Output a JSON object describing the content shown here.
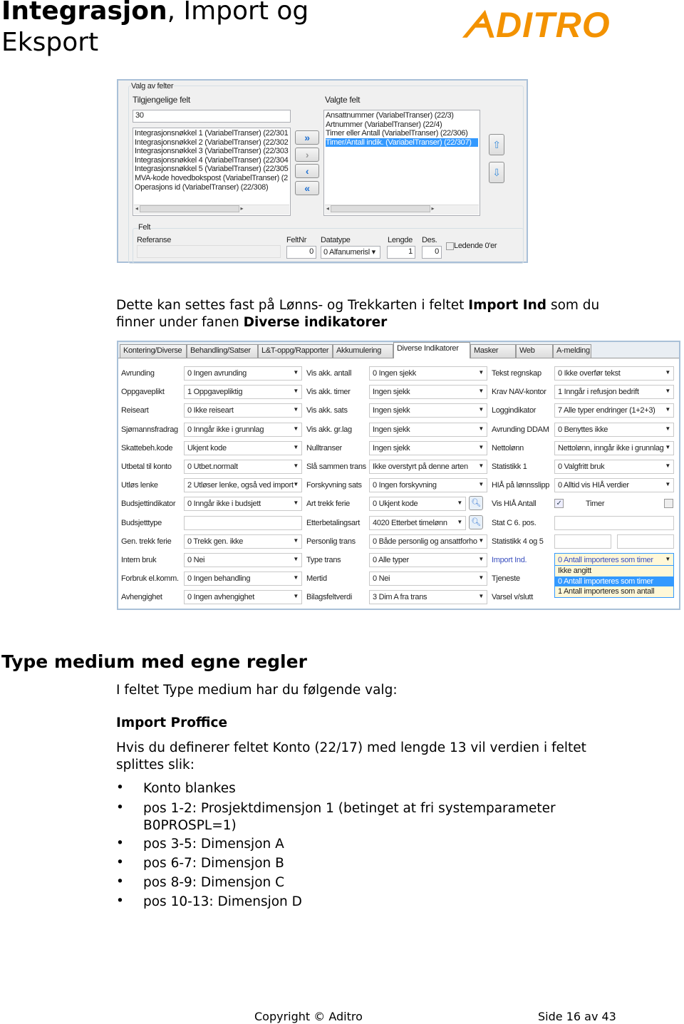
{
  "header": {
    "title_bold": "Integrasjon",
    "title_rest": ", Import og Eksport",
    "logo_text": "ADITRO",
    "logo_color": "#f39200"
  },
  "field_picker": {
    "group_label": "Valg av felter",
    "available_label": "Tilgjengelige felt",
    "search_value": "30",
    "available_items": [
      "Integrasjonsnøkkel 1 (VariabelTranser) (22/301",
      "Integrasjonsnøkkel 2 (VariabelTranser) (22/302",
      "Integrasjonsnøkkel 3 (VariabelTranser) (22/303",
      "Integrasjonsnøkkel 4 (VariabelTranser) (22/304",
      "Integrasjonsnøkkel 5 (VariabelTranser) (22/305",
      "MVA-kode hovedbokspost (VariabelTranser) (2",
      "Operasjons id (VariabelTranser) (22/308)"
    ],
    "selected_label": "Valgte felt",
    "selected_items": [
      "Ansattnummer (VariabelTranser) (22/3)",
      "Artnummer (VariabelTranser) (22/4)",
      "Timer eller Antall (VariabelTranser) (22/306)",
      "Timer/Antall indik. (VariabelTranser) (22/307)"
    ],
    "highlighted_index": 3,
    "buttons": {
      "add_all": "»",
      "add": "›",
      "remove": "‹",
      "remove_all": "«",
      "up": "⇧",
      "down": "⇩"
    },
    "felt": {
      "group_label": "Felt",
      "ref_label": "Referanse",
      "ref_value": "",
      "feltnr_label": "FeltNr",
      "feltnr_value": "0",
      "datatype_label": "Datatype",
      "datatype_value": "0 Alfanumerisl",
      "lengde_label": "Lengde",
      "lengde_value": "1",
      "des_label": "Des.",
      "des_value": "0",
      "leading_zero_label": "Ledende 0'er"
    }
  },
  "para1": {
    "text1": "Dette kan settes fast på Lønns- og Trekkarten i feltet ",
    "bold1": "Import Ind",
    "text2": " som du finner under fanen ",
    "bold2": "Diverse indikatorer"
  },
  "indicators": {
    "tabs": [
      "Kontering/Diverse",
      "Behandling/Satser",
      "L&T-oppg/Rapporter",
      "Akkumulering",
      "Diverse Indikatorer",
      "Masker",
      "Web",
      "A-melding"
    ],
    "active_tab": 4,
    "col1": [
      {
        "label": "Avrunding",
        "value": "0 Ingen avrunding"
      },
      {
        "label": "Oppgaveplikt",
        "value": "1 Oppgavepliktig"
      },
      {
        "label": "Reiseart",
        "value": "0 Ikke reiseart"
      },
      {
        "label": "Sjømannsfradrag",
        "value": "0 Inngår ikke i grunnlag"
      },
      {
        "label": "Skattebeh.kode",
        "value": "Ukjent kode"
      },
      {
        "label": "Utbetal til konto",
        "value": "0 Utbet.normalt"
      },
      {
        "label": "Utløs lenke",
        "value": "2 Utløser lenke, også ved import"
      },
      {
        "label": "Budsjettindikator",
        "value": "0 Inngår ikke i budsjett"
      },
      {
        "label": "Budsjetttype",
        "value": "",
        "text": true
      },
      {
        "label": "Gen. trekk ferie",
        "value": "0 Trekk gen. ikke"
      },
      {
        "label": "Intern bruk",
        "value": "0 Nei"
      },
      {
        "label": "Forbruk el.komm.",
        "value": "0 Ingen behandling"
      },
      {
        "label": "Avhengighet",
        "value": "0 Ingen avhengighet"
      }
    ],
    "col2": [
      {
        "label": "Vis akk. antall",
        "value": "0 Ingen sjekk"
      },
      {
        "label": "Vis akk. timer",
        "value": "Ingen sjekk"
      },
      {
        "label": "Vis akk. sats",
        "value": "Ingen sjekk"
      },
      {
        "label": "Vis akk. gr.lag",
        "value": "Ingen sjekk"
      },
      {
        "label": "Nulltranser",
        "value": "Ingen sjekk"
      },
      {
        "label": "Slå sammen trans",
        "value": "Ikke overstyrt på denne arten"
      },
      {
        "label": "Forskyvning sats",
        "value": "0 Ingen forskyvning"
      },
      {
        "label": "Art trekk ferie",
        "value": "0 Ukjent kode",
        "lookup": true
      },
      {
        "label": "Etterbetalingsart",
        "value": "4020 Etterbet timelønn",
        "lookup": true
      },
      {
        "label": "Personlig trans",
        "value": "0 Både personlig og ansattforho"
      },
      {
        "label": "Type trans",
        "value": "0 Alle typer"
      },
      {
        "label": "Mertid",
        "value": "0 Nei"
      },
      {
        "label": "Bilagsfeltverdi",
        "value": "3 Dim A fra trans"
      }
    ],
    "col3": [
      {
        "label": "Tekst regnskap",
        "value": "0 Ikke overfør tekst"
      },
      {
        "label": "Krav NAV-kontor",
        "value": "1 Inngår i refusjon bedrift"
      },
      {
        "label": "Loggindikator",
        "value": "7 Alle typer endringer (1+2+3)"
      },
      {
        "label": "Avrunding DDAM",
        "value": "0 Benyttes ikke"
      },
      {
        "label": "Nettolønn",
        "value": "Nettolønn, inngår ikke i grunnlag"
      },
      {
        "label": "Statistikk 1",
        "value": "0 Valgfritt bruk"
      },
      {
        "label": "HIÅ på lønnsslipp",
        "value": "0 Alltid vis HIÅ verdier"
      },
      {
        "label": "Vis HIÅ Antall",
        "checkbox": true,
        "checked": true,
        "extra_label": "Timer",
        "extra_checked": false
      },
      {
        "label": "Stat C 6. pos.",
        "value": "",
        "text": true
      },
      {
        "label": "Statistikk 4 og 5",
        "value": "",
        "split": true
      },
      {
        "label": "Import Ind.",
        "value": "0 Antall importeres som timer",
        "focus": true
      },
      {
        "label": "Tjeneste",
        "value": "",
        "hidden": true
      },
      {
        "label": "Varsel v/slutt",
        "value": "",
        "hidden": true
      }
    ],
    "dropdown_options": [
      "Ikke angitt",
      "0 Antall importeres som timer",
      "1 Antall importeres som antall"
    ],
    "dropdown_selected": 1
  },
  "section": {
    "title": "Type medium med egne regler",
    "intro": "I feltet Type medium har du følgende valg:",
    "subtitle": "Import Proffice",
    "para": "Hvis du definerer feltet Konto (22/17) med lengde 13 vil verdien i feltet splittes slik:",
    "bullets": [
      "Konto blankes",
      "pos 1-2: Prosjektdimensjon 1 (betinget at fri systemparameter B0PROSPL=1)",
      "pos 3-5: Dimensjon A",
      "pos 6-7: Dimensjon B",
      "pos 8-9: Dimensjon C",
      "pos 10-13: Dimensjon D"
    ]
  },
  "footer": {
    "copyright": "Copyright © Aditro",
    "page": "Side 16 av 43"
  }
}
